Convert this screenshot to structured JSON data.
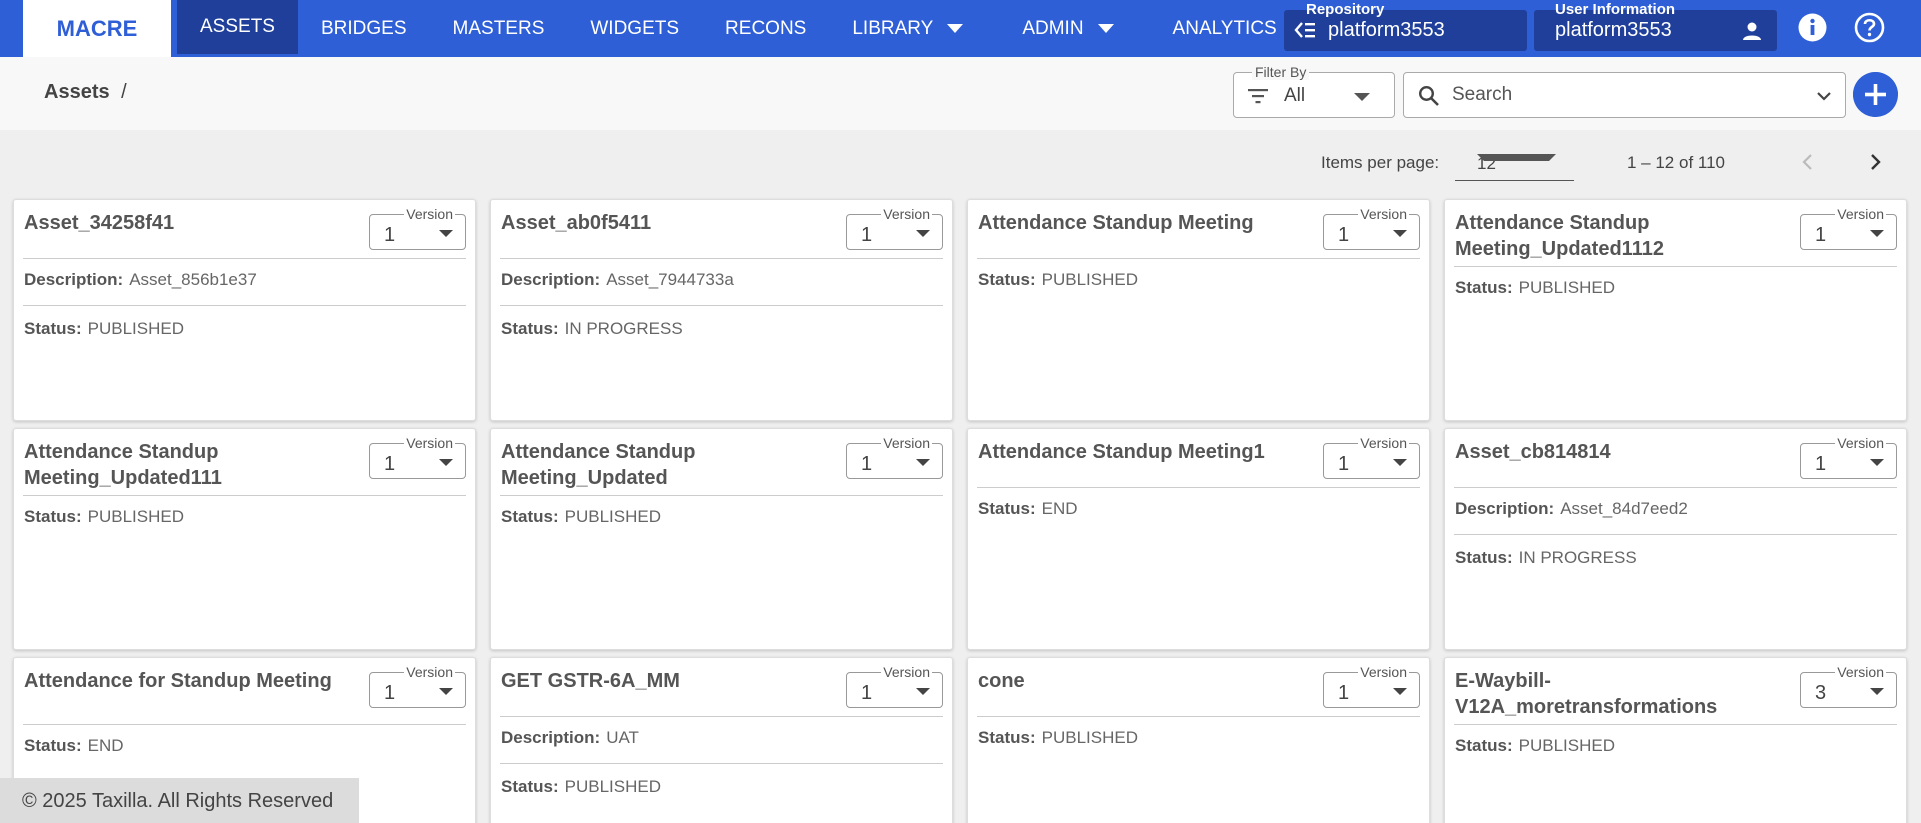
{
  "nav": {
    "logo": "MACRE",
    "items": [
      {
        "label": "ASSETS"
      },
      {
        "label": "BRIDGES"
      },
      {
        "label": "MASTERS"
      },
      {
        "label": "WIDGETS"
      },
      {
        "label": "RECONS"
      },
      {
        "label": "LIBRARY"
      },
      {
        "label": "ADMIN"
      },
      {
        "label": "ANALYTICS"
      }
    ],
    "repository": {
      "label": "Repository",
      "value": "platform3553"
    },
    "user_info": {
      "label": "User Information",
      "value": "platform3553"
    },
    "icons": {
      "info": "info-icon",
      "help": "help-icon"
    },
    "accent_color": "#2f5fd6"
  },
  "breadcrumb": {
    "current": "Assets",
    "separator": "/"
  },
  "filter": {
    "label": "Filter By",
    "value": "All"
  },
  "search": {
    "placeholder": "Search"
  },
  "pagination": {
    "label": "Items per page:",
    "per_page": "12",
    "range": "1 – 12 of 110"
  },
  "cards": [
    {
      "title": "Asset_34258f41",
      "version_label": "Version",
      "version": "1",
      "description_label": "Description:",
      "description": "Asset_856b1e37",
      "status_label": "Status:",
      "status": "PUBLISHED"
    },
    {
      "title": "Asset_ab0f5411",
      "version_label": "Version",
      "version": "1",
      "description_label": "Description:",
      "description": "Asset_7944733a",
      "status_label": "Status:",
      "status": "IN PROGRESS"
    },
    {
      "title": "Attendance Standup Meeting",
      "version_label": "Version",
      "version": "1",
      "status_label": "Status:",
      "status": "PUBLISHED"
    },
    {
      "title": "Attendance Standup Meeting_Updated1112",
      "version_label": "Version",
      "version": "1",
      "status_label": "Status:",
      "status": "PUBLISHED"
    },
    {
      "title": "Attendance Standup Meeting_Updated111",
      "version_label": "Version",
      "version": "1",
      "status_label": "Status:",
      "status": "PUBLISHED"
    },
    {
      "title": "Attendance Standup Meeting_Updated",
      "version_label": "Version",
      "version": "1",
      "status_label": "Status:",
      "status": "PUBLISHED"
    },
    {
      "title": "Attendance Standup Meeting1",
      "version_label": "Version",
      "version": "1",
      "status_label": "Status:",
      "status": "END"
    },
    {
      "title": "Asset_cb814814",
      "version_label": "Version",
      "version": "1",
      "description_label": "Description:",
      "description": "Asset_84d7eed2",
      "status_label": "Status:",
      "status": "IN PROGRESS"
    },
    {
      "title": "Attendance for Standup Meeting",
      "version_label": "Version",
      "version": "1",
      "status_label": "Status:",
      "status": "END"
    },
    {
      "title": "GET GSTR-6A_MM",
      "version_label": "Version",
      "version": "1",
      "description_label": "Description:",
      "description": "UAT",
      "status_label": "Status:",
      "status": "PUBLISHED"
    },
    {
      "title": "cone",
      "version_label": "Version",
      "version": "1",
      "status_label": "Status:",
      "status": "PUBLISHED"
    },
    {
      "title": "E-Waybill-V12A_moretransformations",
      "version_label": "Version",
      "version": "3",
      "status_label": "Status:",
      "status": "PUBLISHED"
    }
  ],
  "footer": {
    "text": "© 2025 Taxilla. All Rights Reserved"
  }
}
